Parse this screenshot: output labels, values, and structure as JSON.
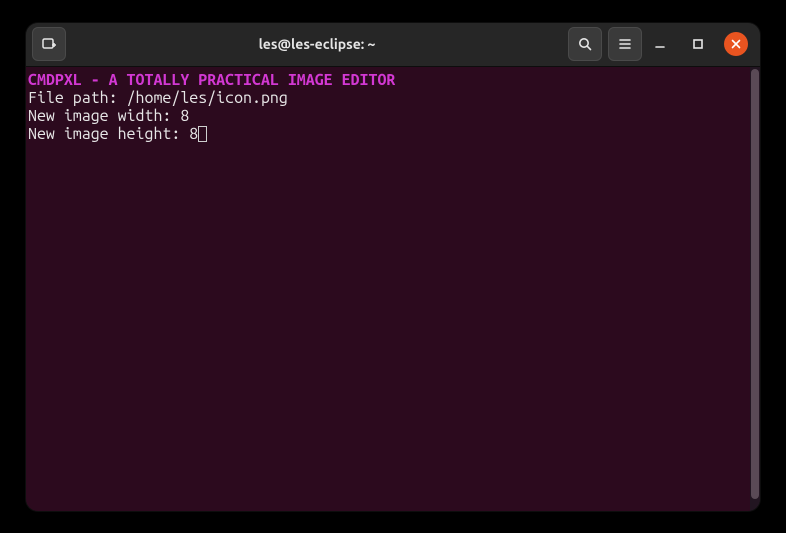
{
  "window": {
    "title": "les@les-eclipse: ~"
  },
  "terminal": {
    "banner": "CMDPXL - A TOTALLY PRACTICAL IMAGE EDITOR",
    "line1_label": "File path: ",
    "line1_value": "/home/les/icon.png",
    "line2_label": "New image width: ",
    "line2_value": "8",
    "line3_label": "New image height: ",
    "line3_value": "8"
  }
}
